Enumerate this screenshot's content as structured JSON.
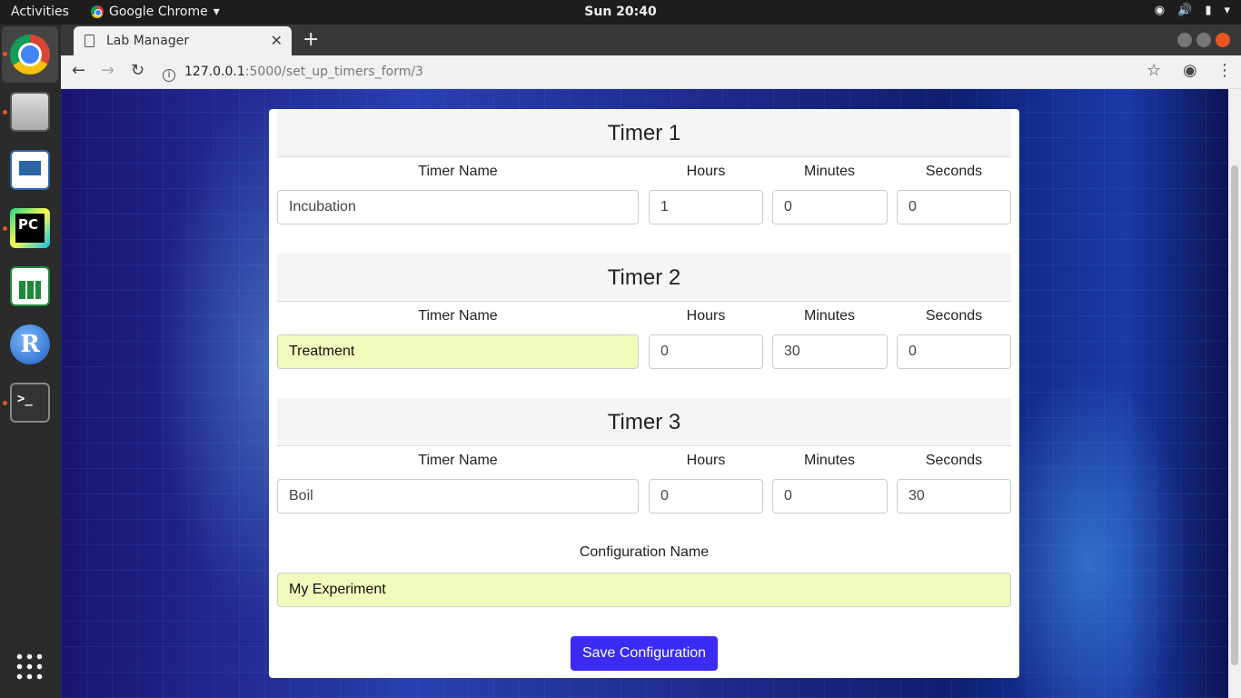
{
  "topbar": {
    "activities": "Activities",
    "app_name": "Google Chrome",
    "clock": "Sun 20:40",
    "tray": [
      "wifi-icon",
      "volume-icon",
      "battery-icon",
      "power-menu-icon"
    ]
  },
  "dock": [
    "chrome",
    "files",
    "impress",
    "pycharm",
    "calc",
    "rstudio",
    "terminal",
    "app-grid"
  ],
  "browser": {
    "tab_title": "Lab Manager",
    "url_host": "127.0.0.1",
    "url_path": ":5000/set_up_timers_form/3"
  },
  "form": {
    "timers": [
      {
        "title": "Timer 1",
        "name": "Incubation",
        "hours": "1",
        "minutes": "0",
        "seconds": "0"
      },
      {
        "title": "Timer 2",
        "name": "Treatment",
        "hours": "0",
        "minutes": "30",
        "seconds": "0"
      },
      {
        "title": "Timer 3",
        "name": "Boil",
        "hours": "0",
        "minutes": "0",
        "seconds": "30"
      }
    ],
    "labels": {
      "name": "Timer Name",
      "hours": "Hours",
      "minutes": "Minutes",
      "seconds": "Seconds"
    },
    "config_label": "Configuration Name",
    "config_value": "My Experiment",
    "save_label": "Save Configuration"
  },
  "colors": {
    "autofill": "#f0fbbb",
    "save_button": "#3b2bf5"
  }
}
